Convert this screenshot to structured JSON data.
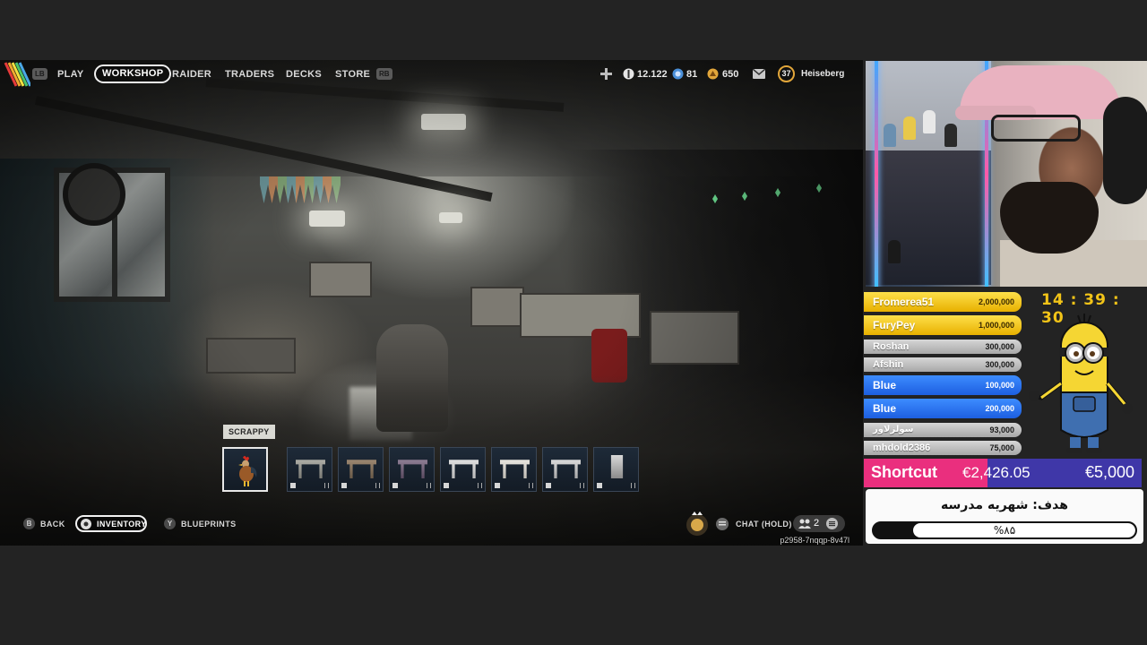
{
  "game": {
    "nav": {
      "lb": "LB",
      "rb": "RB",
      "items": [
        "PLAY",
        "WORKSHOP",
        "RAIDER",
        "TRADERS",
        "DECKS",
        "STORE"
      ],
      "active": "WORKSHOP"
    },
    "currencies": {
      "coins": "12.122",
      "blue": "81",
      "gold": "650"
    },
    "player": {
      "level": "37",
      "name": "Heiseberg"
    },
    "inventory": {
      "selected_label": "SCRAPPY",
      "slots": [
        "scrappy",
        "workbench-1",
        "workbench-2",
        "workbench-3",
        "workbench-4",
        "workbench-5",
        "workbench-6",
        "workbench-7"
      ]
    },
    "bottom": {
      "back_key": "B",
      "back_label": "BACK",
      "inventory_label": "INVENTORY",
      "blueprints_key": "Y",
      "blueprints_label": "BLUEPRINTS",
      "chat_label": "CHAT (HOLD)",
      "party_count": "2",
      "session_id": "p2958-7nqqp-8v47l"
    }
  },
  "overlay": {
    "timer": "14 : 39 : 30",
    "donors": [
      {
        "name": "Fromerea51",
        "amount": "2,000,000",
        "tier": "gold"
      },
      {
        "name": "FuryPey",
        "amount": "1,000,000",
        "tier": "gold"
      },
      {
        "name": "Roshan",
        "amount": "300,000",
        "tier": "silver"
      },
      {
        "name": "Afshin",
        "amount": "300,000",
        "tier": "silver"
      },
      {
        "name": "Blue",
        "amount": "100,000",
        "tier": "blue"
      },
      {
        "name": "Blue",
        "amount": "200,000",
        "tier": "blue"
      },
      {
        "name": "سولزلاور",
        "amount": "93,000",
        "tier": "silver"
      },
      {
        "name": "mhdold2386",
        "amount": "75,000",
        "tier": "silver"
      }
    ],
    "goal": {
      "name": "Shortcut",
      "current": "€2,426.05",
      "target": "€5,000",
      "title": "هدف: شهریه مدرسه",
      "percent_label": "%۸۵",
      "progress": 0.85
    }
  },
  "colors": {
    "accent_gold": "#f2c418",
    "goal_pink": "#ea2f7e",
    "goal_blue": "#3f37a8",
    "donor_blue": "#1d5fe0"
  }
}
